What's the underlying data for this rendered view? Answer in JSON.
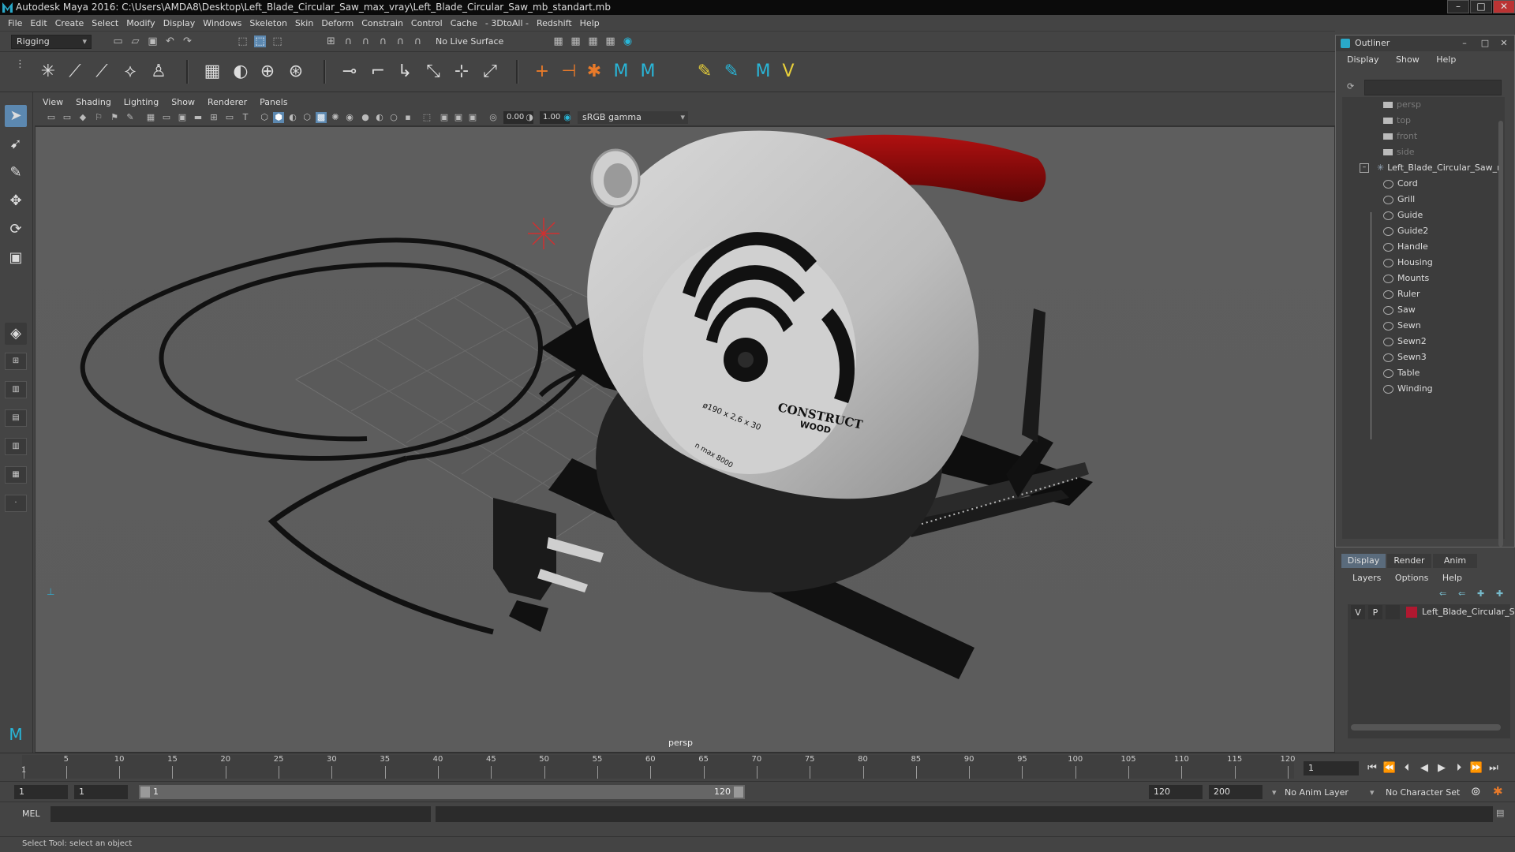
{
  "window": {
    "title": "Autodesk Maya 2016: C:\\Users\\AMDA8\\Desktop\\Left_Blade_Circular_Saw_max_vray\\Left_Blade_Circular_Saw_mb_standart.mb"
  },
  "menubar": [
    "File",
    "Edit",
    "Create",
    "Select",
    "Modify",
    "Display",
    "Windows",
    "Skeleton",
    "Skin",
    "Deform",
    "Constrain",
    "Control",
    "Cache",
    "- 3DtoAll -",
    "Redshift",
    "Help"
  ],
  "toolbar": {
    "mode": "Rigging",
    "live_surface": "No Live Surface"
  },
  "viewport": {
    "menu": [
      "View",
      "Shading",
      "Lighting",
      "Show",
      "Renderer",
      "Panels"
    ],
    "field_a": "0.00",
    "field_b": "1.00",
    "color_mgmt": "sRGB gamma",
    "camera": "persp",
    "saw_label_1": "CONSTRUCT",
    "saw_label_2": "WOOD",
    "saw_spec": "ø190 x 2,6 x 30",
    "saw_rpm": "n max 8000"
  },
  "outliner": {
    "title": "Outliner",
    "menu": [
      "Display",
      "Show",
      "Help"
    ],
    "cameras": [
      "persp",
      "top",
      "front",
      "side"
    ],
    "root": "Left_Blade_Circular_Saw_r",
    "children": [
      "Cord",
      "Grill",
      "Guide",
      "Guide2",
      "Handle",
      "Housing",
      "Mounts",
      "Ruler",
      "Saw",
      "Sewn",
      "Sewn2",
      "Sewn3",
      "Table",
      "Winding"
    ]
  },
  "layers": {
    "tabs": [
      "Display",
      "Render",
      "Anim"
    ],
    "menu": [
      "Layers",
      "Options",
      "Help"
    ],
    "layer": {
      "v": "V",
      "p": "P",
      "name": "Left_Blade_Circular_Sa",
      "color": "#b01830"
    }
  },
  "timeline": {
    "ticks": [
      "1",
      "5",
      "10",
      "15",
      "20",
      "25",
      "30",
      "35",
      "40",
      "45",
      "50",
      "55",
      "60",
      "65",
      "70",
      "75",
      "80",
      "85",
      "90",
      "95",
      "100",
      "105",
      "110",
      "115",
      "120"
    ],
    "current_frame": "1"
  },
  "range": {
    "start": "1",
    "playback_start": "1",
    "slider_start": "1",
    "slider_end": "120",
    "playback_end": "120",
    "end": "200",
    "anim_layer": "No Anim Layer",
    "char_set": "No Character Set"
  },
  "command": {
    "lang": "MEL"
  },
  "status": {
    "text": "Select Tool: select an object"
  }
}
